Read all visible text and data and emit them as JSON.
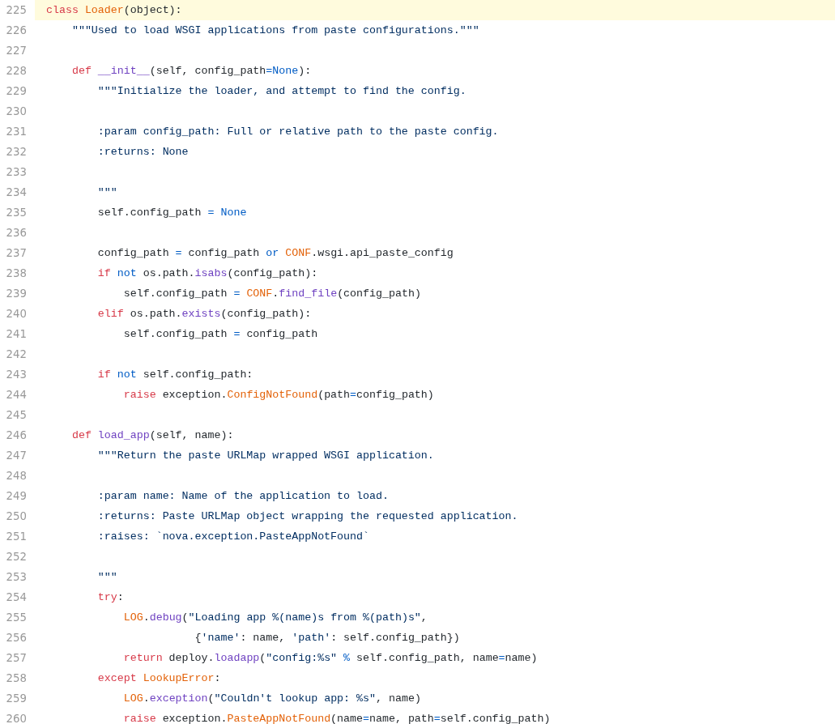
{
  "code_view": {
    "lines": [
      {
        "number": "225",
        "highlighted": true,
        "tokens": [
          {
            "kind": "keyword",
            "text": "class"
          },
          {
            "kind": "class",
            "text": " Loader"
          },
          {
            "kind": "plain",
            "text": "(object):"
          }
        ]
      },
      {
        "number": "226",
        "highlighted": false,
        "tokens": [
          {
            "kind": "string",
            "text": "    \"\"\"Used to load WSGI applications from paste configurations.\"\"\""
          }
        ]
      },
      {
        "number": "227",
        "highlighted": false
      },
      {
        "number": "228",
        "highlighted": false,
        "tokens": [
          {
            "kind": "keyword",
            "text": "    def"
          },
          {
            "kind": "function",
            "text": " __init__"
          },
          {
            "kind": "plain",
            "text": "(self, config_path"
          },
          {
            "kind": "operator",
            "text": "="
          },
          {
            "kind": "operator",
            "text": "None"
          },
          {
            "kind": "plain",
            "text": "):"
          }
        ]
      },
      {
        "number": "229",
        "highlighted": false,
        "tokens": [
          {
            "kind": "string",
            "text": "        \"\"\"Initialize the loader, and attempt to find the config."
          }
        ]
      },
      {
        "number": "230",
        "highlighted": false
      },
      {
        "number": "231",
        "highlighted": false,
        "tokens": [
          {
            "kind": "string",
            "text": "        :param config_path: Full or relative path to the paste config."
          }
        ]
      },
      {
        "number": "232",
        "highlighted": false,
        "tokens": [
          {
            "kind": "string",
            "text": "        :returns: None"
          }
        ]
      },
      {
        "number": "233",
        "highlighted": false
      },
      {
        "number": "234",
        "highlighted": false,
        "tokens": [
          {
            "kind": "string",
            "text": "        \"\"\""
          }
        ]
      },
      {
        "number": "235",
        "highlighted": false,
        "tokens": [
          {
            "kind": "plain",
            "text": "        self.config_path"
          },
          {
            "kind": "operator",
            "text": " ="
          },
          {
            "kind": "operator",
            "text": " None"
          }
        ]
      },
      {
        "number": "236",
        "highlighted": false
      },
      {
        "number": "237",
        "highlighted": false,
        "tokens": [
          {
            "kind": "plain",
            "text": "        config_path"
          },
          {
            "kind": "operator",
            "text": " ="
          },
          {
            "kind": "plain",
            "text": " config_path"
          },
          {
            "kind": "operator",
            "text": " or"
          },
          {
            "kind": "class",
            "text": " CONF"
          },
          {
            "kind": "plain",
            "text": ".wsgi.api_paste_config"
          }
        ]
      },
      {
        "number": "238",
        "highlighted": false,
        "tokens": [
          {
            "kind": "keyword",
            "text": "        if"
          },
          {
            "kind": "operator",
            "text": " not"
          },
          {
            "kind": "plain",
            "text": " os.path."
          },
          {
            "kind": "function",
            "text": "isabs"
          },
          {
            "kind": "plain",
            "text": "(config_path):"
          }
        ]
      },
      {
        "number": "239",
        "highlighted": false,
        "tokens": [
          {
            "kind": "plain",
            "text": "            self.config_path"
          },
          {
            "kind": "operator",
            "text": " ="
          },
          {
            "kind": "class",
            "text": " CONF"
          },
          {
            "kind": "plain",
            "text": "."
          },
          {
            "kind": "function",
            "text": "find_file"
          },
          {
            "kind": "plain",
            "text": "(config_path)"
          }
        ]
      },
      {
        "number": "240",
        "highlighted": false,
        "tokens": [
          {
            "kind": "keyword",
            "text": "        elif"
          },
          {
            "kind": "plain",
            "text": " os.path."
          },
          {
            "kind": "function",
            "text": "exists"
          },
          {
            "kind": "plain",
            "text": "(config_path):"
          }
        ]
      },
      {
        "number": "241",
        "highlighted": false,
        "tokens": [
          {
            "kind": "plain",
            "text": "            self.config_path"
          },
          {
            "kind": "operator",
            "text": " ="
          },
          {
            "kind": "plain",
            "text": " config_path"
          }
        ]
      },
      {
        "number": "242",
        "highlighted": false
      },
      {
        "number": "243",
        "highlighted": false,
        "tokens": [
          {
            "kind": "keyword",
            "text": "        if"
          },
          {
            "kind": "operator",
            "text": " not"
          },
          {
            "kind": "plain",
            "text": " self.config_path:"
          }
        ]
      },
      {
        "number": "244",
        "highlighted": false,
        "tokens": [
          {
            "kind": "keyword",
            "text": "            raise"
          },
          {
            "kind": "plain",
            "text": " exception."
          },
          {
            "kind": "class",
            "text": "ConfigNotFound"
          },
          {
            "kind": "plain",
            "text": "(path"
          },
          {
            "kind": "operator",
            "text": "="
          },
          {
            "kind": "plain",
            "text": "config_path)"
          }
        ]
      },
      {
        "number": "245",
        "highlighted": false
      },
      {
        "number": "246",
        "highlighted": false,
        "tokens": [
          {
            "kind": "keyword",
            "text": "    def"
          },
          {
            "kind": "function",
            "text": " load_app"
          },
          {
            "kind": "plain",
            "text": "(self, name):"
          }
        ]
      },
      {
        "number": "247",
        "highlighted": false,
        "tokens": [
          {
            "kind": "string",
            "text": "        \"\"\"Return the paste URLMap wrapped WSGI application."
          }
        ]
      },
      {
        "number": "248",
        "highlighted": false
      },
      {
        "number": "249",
        "highlighted": false,
        "tokens": [
          {
            "kind": "string",
            "text": "        :param name: Name of the application to load."
          }
        ]
      },
      {
        "number": "250",
        "highlighted": false,
        "tokens": [
          {
            "kind": "string",
            "text": "        :returns: Paste URLMap object wrapping the requested application."
          }
        ]
      },
      {
        "number": "251",
        "highlighted": false,
        "tokens": [
          {
            "kind": "string",
            "text": "        :raises: `nova.exception.PasteAppNotFound`"
          }
        ]
      },
      {
        "number": "252",
        "highlighted": false
      },
      {
        "number": "253",
        "highlighted": false,
        "tokens": [
          {
            "kind": "string",
            "text": "        \"\"\""
          }
        ]
      },
      {
        "number": "254",
        "highlighted": false,
        "tokens": [
          {
            "kind": "keyword",
            "text": "        try"
          },
          {
            "kind": "plain",
            "text": ":"
          }
        ]
      },
      {
        "number": "255",
        "highlighted": false,
        "tokens": [
          {
            "kind": "class",
            "text": "            LOG"
          },
          {
            "kind": "plain",
            "text": "."
          },
          {
            "kind": "function",
            "text": "debug"
          },
          {
            "kind": "plain",
            "text": "("
          },
          {
            "kind": "string",
            "text": "\"Loading app %(name)s from %(path)s\""
          },
          {
            "kind": "plain",
            "text": ","
          }
        ]
      },
      {
        "number": "256",
        "highlighted": false,
        "tokens": [
          {
            "kind": "plain",
            "text": "                       {"
          },
          {
            "kind": "string",
            "text": "'name'"
          },
          {
            "kind": "plain",
            "text": ": name, "
          },
          {
            "kind": "string",
            "text": "'path'"
          },
          {
            "kind": "plain",
            "text": ": self.config_path})"
          }
        ]
      },
      {
        "number": "257",
        "highlighted": false,
        "tokens": [
          {
            "kind": "keyword",
            "text": "            return"
          },
          {
            "kind": "plain",
            "text": " deploy."
          },
          {
            "kind": "function",
            "text": "loadapp"
          },
          {
            "kind": "plain",
            "text": "("
          },
          {
            "kind": "string",
            "text": "\"config:%s\""
          },
          {
            "kind": "operator",
            "text": " %"
          },
          {
            "kind": "plain",
            "text": " self.config_path, name"
          },
          {
            "kind": "operator",
            "text": "="
          },
          {
            "kind": "plain",
            "text": "name)"
          }
        ]
      },
      {
        "number": "258",
        "highlighted": false,
        "tokens": [
          {
            "kind": "keyword",
            "text": "        except"
          },
          {
            "kind": "class",
            "text": " LookupError"
          },
          {
            "kind": "plain",
            "text": ":"
          }
        ]
      },
      {
        "number": "259",
        "highlighted": false,
        "tokens": [
          {
            "kind": "class",
            "text": "            LOG"
          },
          {
            "kind": "plain",
            "text": "."
          },
          {
            "kind": "function",
            "text": "exception"
          },
          {
            "kind": "plain",
            "text": "("
          },
          {
            "kind": "string",
            "text": "\"Couldn't lookup app: %s\""
          },
          {
            "kind": "plain",
            "text": ", name)"
          }
        ]
      },
      {
        "number": "260",
        "highlighted": false,
        "tokens": [
          {
            "kind": "keyword",
            "text": "            raise"
          },
          {
            "kind": "plain",
            "text": " exception."
          },
          {
            "kind": "class",
            "text": "PasteAppNotFound"
          },
          {
            "kind": "plain",
            "text": "(name"
          },
          {
            "kind": "operator",
            "text": "="
          },
          {
            "kind": "plain",
            "text": "name, path"
          },
          {
            "kind": "operator",
            "text": "="
          },
          {
            "kind": "plain",
            "text": "self.config_path)"
          }
        ]
      }
    ]
  }
}
